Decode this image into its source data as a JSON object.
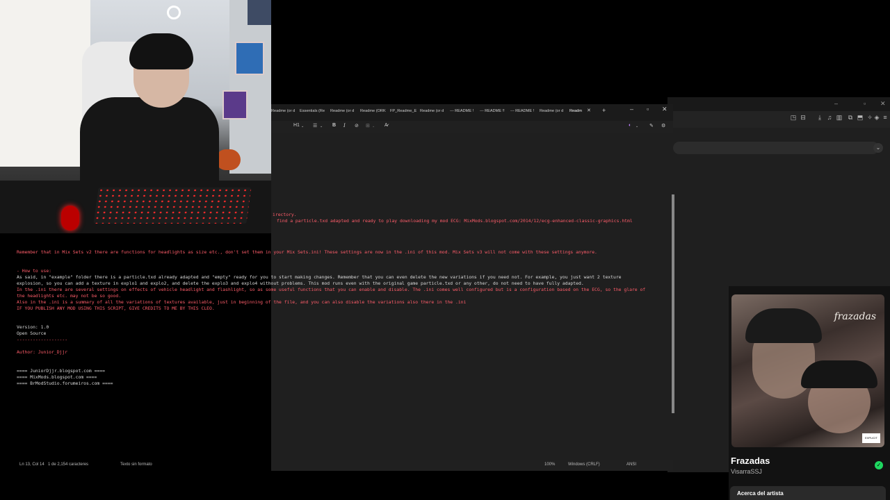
{
  "notepad": {
    "tabs": [
      {
        "label": "Readme (or d"
      },
      {
        "label": "Essentials (Re"
      },
      {
        "label": "Readme (or d"
      },
      {
        "label": "Readme (ORK"
      },
      {
        "label": "FP_Readme_E"
      },
      {
        "label": "Readme (or d"
      },
      {
        "label": "--- README !"
      },
      {
        "label": "--- README !!"
      },
      {
        "label": "--- README !"
      },
      {
        "label": "Readme (or d"
      },
      {
        "label": "Readm"
      }
    ],
    "heading_select": "H1",
    "lines": [
      {
        "text": "irectory.",
        "color": "red"
      },
      {
        "text": "find a particle.txd adapted and ready to play downloading my mod ECG: MixMods.blogspot.com/2014/12/ecg-enhanced-classic-graphics.html",
        "color": "red"
      },
      {
        "text": "Remember that in Mix Sets v2 there are functions for headlights as size etc., don't set them in your Mix Sets.ini! These settings are now in the .ini of this mod. Mix Sets v3 will not come with these settings anymore.",
        "color": "red"
      },
      {
        "text": "- How to use:",
        "color": "red"
      },
      {
        "text": "As said, in \"example\" folder there is a particle.txd already adapted and \"empty\" ready for you to start making changes. Remember that you can even delete the new variations if you need not. For example, you just want 2 texture",
        "color": "white"
      },
      {
        "text": "explosion, so you can add a texture in explo1 and explo2, and delete the explo3 and explo4 without problems. This mod runs even with the original game particle.txd or any other, do not need to have fully adapted.",
        "color": "white"
      },
      {
        "text": "In the .ini there are several settings on effects of vehicle headlight and flashlight, so as some useful functions that you can enable and disable. The .ini comes well configured but is a configuration based on the ECG, so the glare of",
        "color": "red"
      },
      {
        "text": "the headlights etc. may not be so good.",
        "color": "red"
      },
      {
        "text": "Also in the .ini is a summary of all the variations of textures available, just in beginning of the file, and you can also disable the variations also there in the .ini",
        "color": "red"
      },
      {
        "text": "IF YOU PUBLISH ANY MOD USING THIS SCRIPT, GIVE CREDITS TO ME BY THIS CLEO.",
        "color": "red"
      },
      {
        "text": "Version: 1.0",
        "color": "white"
      },
      {
        "text": "Open Source",
        "color": "white"
      },
      {
        "text": "-------------------",
        "color": "red"
      },
      {
        "text": "Author: Junior_Djjr",
        "color": "red"
      },
      {
        "text": "====   JuniorDjjr.blogspot.com     ====",
        "color": "white"
      },
      {
        "text": "====   MixMods.blogspot.com        ====",
        "color": "white"
      },
      {
        "text": "====   BrModStudio.forumeiros.com  ====",
        "color": "white"
      }
    ],
    "status": {
      "position": "Ln 13, Col 14",
      "chars": "1 de 2,154 caracteres",
      "format": "Texto sin formato",
      "zoom": "100%",
      "line_ending": "Windows (CRLF)",
      "encoding": "ANSI"
    }
  },
  "player": {
    "cover_text": "frazadas",
    "song_title": "Frazadas",
    "artist": "VisarraSSJ",
    "about_label": "Acerca del artista",
    "accent": "#1ed760"
  }
}
